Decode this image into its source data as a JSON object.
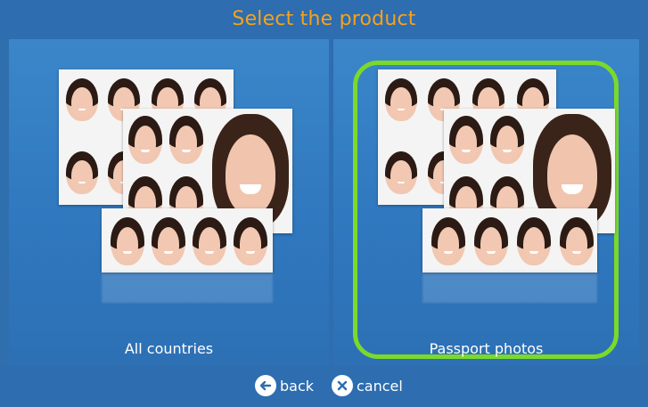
{
  "header": {
    "title": "Select the product"
  },
  "products": [
    {
      "label": "All countries",
      "selected": false
    },
    {
      "label": "Passport photos",
      "selected": true
    }
  ],
  "footer": {
    "back_label": "back",
    "cancel_label": "cancel"
  },
  "colors": {
    "accent_title": "#f7a21a",
    "selection_border": "#7bd92a",
    "background": "#2d6db0"
  },
  "icons": {
    "back": "arrow-left-circle-icon",
    "cancel": "x-circle-icon"
  }
}
